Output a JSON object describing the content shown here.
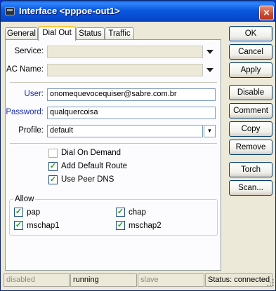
{
  "window": {
    "title": "Interface <pppoe-out1>"
  },
  "tabs": [
    {
      "label": "General",
      "active": false
    },
    {
      "label": "Dial Out",
      "active": true
    },
    {
      "label": "Status",
      "active": false
    },
    {
      "label": "Traffic",
      "active": false
    }
  ],
  "form": {
    "service": {
      "label": "Service:",
      "value": ""
    },
    "ac_name": {
      "label": "AC Name:",
      "value": ""
    },
    "user": {
      "label": "User:",
      "value": "onomequevocequiser@sabre.com.br"
    },
    "password": {
      "label": "Password:",
      "value": "qualquercoisa"
    },
    "profile": {
      "label": "Profile:",
      "value": "default"
    }
  },
  "options": {
    "dial_on_demand": {
      "label": "Dial On Demand",
      "checked": false
    },
    "add_default_route": {
      "label": "Add Default Route",
      "checked": true
    },
    "use_peer_dns": {
      "label": "Use Peer DNS",
      "checked": true
    }
  },
  "allow": {
    "title": "Allow",
    "pap": {
      "label": "pap",
      "checked": true
    },
    "chap": {
      "label": "chap",
      "checked": true
    },
    "mschap1": {
      "label": "mschap1",
      "checked": true
    },
    "mschap2": {
      "label": "mschap2",
      "checked": true
    }
  },
  "buttons": {
    "ok": "OK",
    "cancel": "Cancel",
    "apply": "Apply",
    "disable": "Disable",
    "comment": "Comment",
    "copy": "Copy",
    "remove": "Remove",
    "torch": "Torch",
    "scan": "Scan..."
  },
  "statusbar": {
    "disabled": "disabled",
    "running": "running",
    "slave": "slave",
    "status": "Status: connected"
  },
  "icons": {
    "close": "×",
    "check": "✓",
    "dropdown": "▾"
  }
}
